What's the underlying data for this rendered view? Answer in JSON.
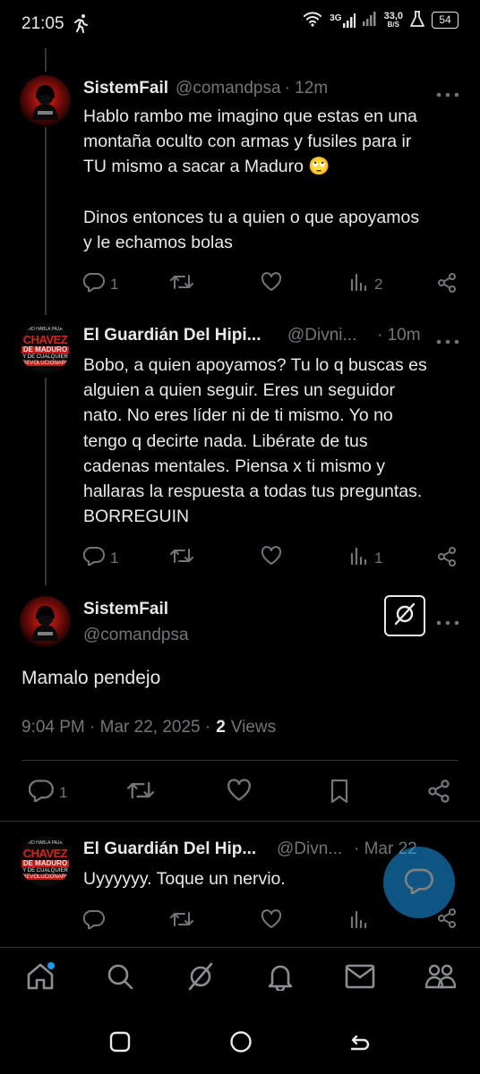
{
  "status_bar": {
    "time": "21:05",
    "network_1": "3G",
    "speed_value": "33,0",
    "speed_unit": "B/S",
    "battery": "54"
  },
  "tweets": [
    {
      "name": "SistemFail",
      "handle": "@comandpsa",
      "time": "· 12m",
      "text_lines": [
        "Hablo rambo me imagino que estas en una",
        "montaña oculto con armas y fusiles para ir",
        "TU mismo a sacar a Maduro 🙄",
        "",
        "Dinos entonces tu a quien o que apoyamos",
        "y le echamos bolas"
      ],
      "replies": "1",
      "retweets": "",
      "likes": "",
      "views": "2"
    },
    {
      "name": "El Guardián Del Hipi...",
      "handle": "@Divni...",
      "time": "· 10m",
      "text_lines": [
        "Bobo, a quien apoyamos? Tu lo q buscas es",
        "alguien a quien seguir. Eres un seguidor",
        "nato. No eres líder ni de ti mismo. Yo no",
        "tengo q decirte nada. Libérate de tus",
        "cadenas mentales. Piensa x ti mismo y",
        "hallaras la respuesta a todas tus preguntas.",
        "BORREGUIN"
      ],
      "replies": "1",
      "retweets": "",
      "likes": "",
      "views": "1"
    }
  ],
  "main_tweet": {
    "name": "SistemFail",
    "handle": "@comandpsa",
    "text": "Mamalo pendejo",
    "timestamp": "9:04 PM · Mar 22, 2025 ·",
    "views_count": "2",
    "views_label": "Views",
    "replies": "1"
  },
  "reply_tweet": {
    "name": "El Guardián Del Hip...",
    "handle": "@Divn...",
    "time": "· Mar 22",
    "text": "Uyyyyyy. Toque un nervio."
  },
  "avatar_badge": {
    "line1": "CHAVEZ",
    "line2": "DE MADURO",
    "line3": "Y DE CUALQUIER",
    "line4": "REVOLUCIONARIO"
  },
  "colors": {
    "background": "#000000",
    "text": "#e7e9ea",
    "muted": "#71767b",
    "accent": "#1d9bf0",
    "divider": "#2f3336"
  },
  "nav": {
    "items": [
      "home-icon",
      "search-icon",
      "grok-icon",
      "notifications-icon",
      "messages-icon",
      "communities-icon"
    ]
  }
}
